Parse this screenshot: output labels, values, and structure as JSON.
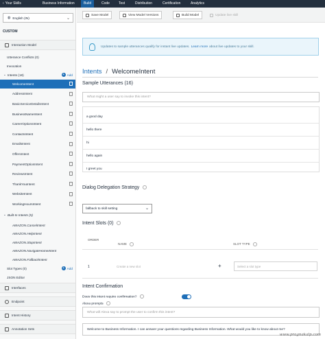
{
  "topnav": {
    "back": "Your Skills",
    "tabs": [
      "Business Information",
      "Build",
      "Code",
      "Test",
      "Distribution",
      "Certification",
      "Analytics"
    ],
    "active_tab": "Build"
  },
  "sidebar": {
    "language": "English (IN)",
    "custom_label": "CUSTOM",
    "interaction_model": "Interaction Model",
    "utterance_conflicts": "Utterance Conflicts (0)",
    "invocation": "Invocation",
    "intents_header": "Intents (18)",
    "add_label": "Add",
    "intents": [
      "WelcomeIntent",
      "AddressIntent",
      "BasicServiceDetailsIntent",
      "BusinessNameIntent",
      "CareerOptionsIntent",
      "ContactsIntent",
      "EmailsIntent",
      "OffersIntent",
      "PaymentOptionIntent",
      "ReviewsIntent",
      "ThankYouIntent",
      "WebsiteIntent",
      "WorkingHoursIntent"
    ],
    "builtin_header": "Built-In Intents (5)",
    "builtin_intents": [
      "AMAZON.CancelIntent",
      "AMAZON.HelpIntent",
      "AMAZON.StopIntent",
      "AMAZON.NavigateHomeIntent",
      "AMAZON.FallbackIntent"
    ],
    "slot_types": "Slot Types (0)",
    "json_editor": "JSON Editor",
    "interfaces": "Interfaces",
    "endpoint": "Endpoint",
    "intent_history": "Intent History",
    "annotation_sets": "Annotation Sets"
  },
  "toolbar": {
    "save": "Save Model",
    "versions": "View Model Versions",
    "build": "Build Model",
    "update": "Update live skill"
  },
  "banner": {
    "text": "Updates to sample utterances qualify for instant live updates.",
    "link": "Learn more",
    "suffix": "about live updates to your skill."
  },
  "breadcrumb": {
    "root": "Intents",
    "sep": "/",
    "current": "WelcomeIntent"
  },
  "utterances": {
    "title": "Sample Utterances (16)",
    "placeholder": "What might a user say to invoke this intent?",
    "items": [
      "a good day",
      "hello there",
      "hi",
      "hello again",
      "I greet you"
    ]
  },
  "delegation": {
    "title": "Dialog Delegation Strategy",
    "value": "fallback to skill setting"
  },
  "slots": {
    "title": "Intent Slots (0)",
    "col_order": "ORDER",
    "col_name": "NAME",
    "col_type": "SLOT TYPE",
    "order_value": "1",
    "name_placeholder": "Create a new slot",
    "type_placeholder": "Select a slot type"
  },
  "confirmation": {
    "title": "Intent Confirmation",
    "question": "Does this intent require confirmation?",
    "alexa_prompts": "Alexa prompts",
    "placeholder": "What will Alexa say to prompt the user to confirm this intent?",
    "prompt_text": "Welcome to Business Information. I can answer your questions regarding Business Information. What would you like to know about me?",
    "enabled": true
  },
  "watermark": "www.pragnakalp.com"
}
